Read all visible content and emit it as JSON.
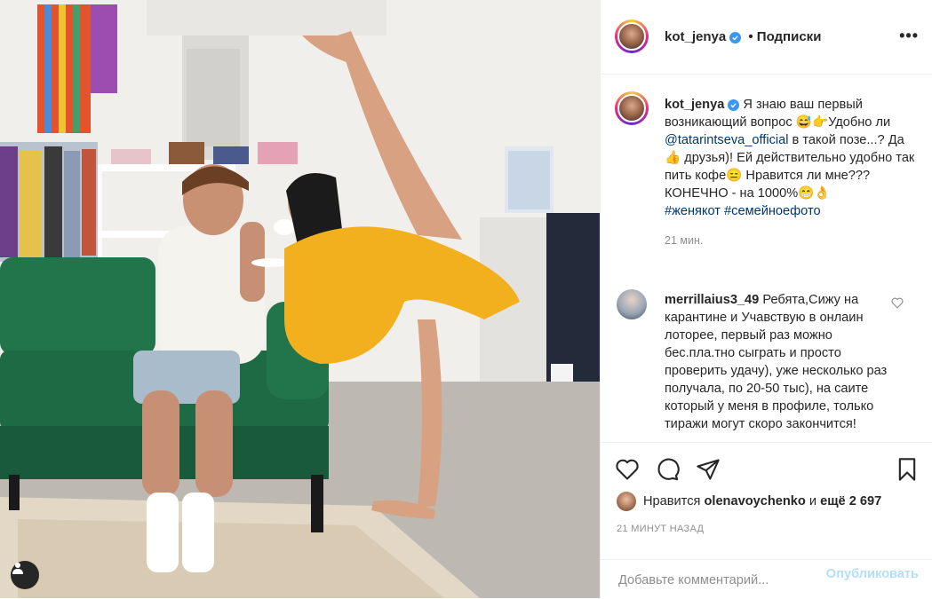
{
  "post": {
    "author": "kot_jenya",
    "follow_status": "• Подписки",
    "more_icon": "more-horizontal-icon"
  },
  "caption": {
    "author": "kot_jenya",
    "text_1": "Я знаю ваш первый возникающий вопрос 😅👉Удобно ли ",
    "mention": "@tatarintseva_official",
    "text_2": " в такой позе...? Да 👍 друзья)! Ей действительно удобно так пить кофе😑 Нравится ли мне??? КОНЕЧНО - на 1000%😁👌",
    "hashtags": "#женякот #семейноефото",
    "time": "21 мин."
  },
  "comment": {
    "author": "merrillaius3_49",
    "text": "Ребята,Сижу на карантине и Учавствую в онлаин лоторее, первый раз можно бес.пла.тно сыграть и просто проверить удачу), уже несколько раз получала, по 20-50 тыс), на саите который у меня в профиле, только тиражи могут скоро закончится!"
  },
  "likes": {
    "prefix": "Нравится",
    "user": "olenavoychenko",
    "and": "и",
    "count": "ещё 2 697"
  },
  "post_time": "21 МИНУТ НАЗАД",
  "composer": {
    "placeholder": "Добавьте комментарий...",
    "publish_label": "Опубликовать"
  },
  "colors": {
    "accent": "#3897f0",
    "publish_disabled": "#b2dffc",
    "sweater": "#f2b01e",
    "sofa": "#1f6b45"
  }
}
